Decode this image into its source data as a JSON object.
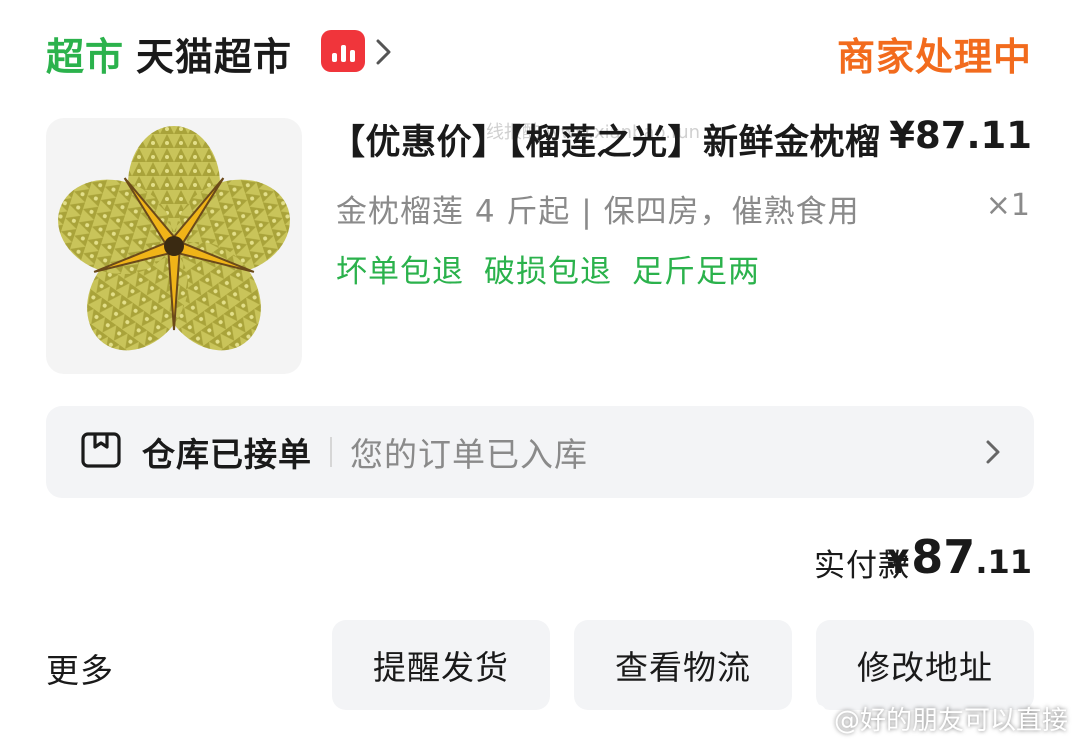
{
  "header": {
    "brand_tag": "超市",
    "store_name": "天猫超市",
    "live_icon": "live-bars-icon",
    "order_status": "商家处理中",
    "colors": {
      "brand_green": "#2bb24c",
      "status_orange": "#f26b1d",
      "live_red": "#f0353b"
    }
  },
  "product": {
    "image_icon": "durian-image",
    "title": "【优惠价】【榴莲之光】新鲜金枕榴",
    "price": "¥87.11",
    "spec": "金枕榴莲 4 斤起 | 保四房，催熟食用",
    "quantity": "×1",
    "tags": [
      "坏单包退",
      "破损包退",
      "足斤足两"
    ],
    "watermark": "线报酷 www.xianbao.fun"
  },
  "warehouse": {
    "icon": "box-icon",
    "title": "仓库已接单",
    "desc": "您的订单已入库"
  },
  "payment": {
    "label": "实付款",
    "currency": "¥",
    "amount_int": "87",
    "amount_dec": ".11"
  },
  "actions": {
    "more_label": "更多",
    "remind_label": "提醒发货",
    "logistics_label": "查看物流",
    "address_label": "修改地址"
  },
  "footer": {
    "weibo_watermark": "@好的朋友可以直接"
  }
}
